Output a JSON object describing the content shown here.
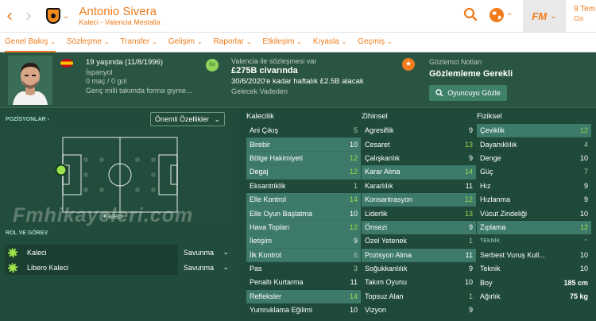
{
  "topbar": {
    "player_name": "Antonio Sivera",
    "player_sub": "Kaleci - Valencia Mestalla",
    "date_main": "9 Tem",
    "date_sub": "Cts"
  },
  "menu": [
    {
      "label": "Genel Bakış",
      "chev": "⌄",
      "active": true
    },
    {
      "label": "Sözleşme",
      "chev": "⌄"
    },
    {
      "label": "Transfer",
      "chev": "⌄"
    },
    {
      "label": "Gelişim",
      "chev": "⌄"
    },
    {
      "label": "Raporlar",
      "chev": "⌄"
    },
    {
      "label": "Etkileşim",
      "chev": "⌄"
    },
    {
      "label": "Kıyasla",
      "chev": "⌄"
    },
    {
      "label": "Geçmiş",
      "chev": "⌄"
    }
  ],
  "header": {
    "age": "19 yaşında (11/8/1996)",
    "nationality": "İspanyol",
    "apps": "0 maç / 0 gol",
    "desc": "Genç milli takımda forma giyme...",
    "contract_icon": "Kir",
    "contract_label": "Valencia ile sözleşmesi var",
    "contract_value": "£275B civarında",
    "contract_until": "30/6/2020'e kadar haftalık £2.5B alacak",
    "contract_future": "Gelecek Vadeden",
    "scout_label": "Gözlemci Notları",
    "scout_value": "Gözlemleme Gerekli",
    "scout_button": "Oyuncuyu Gözle"
  },
  "left": {
    "positions_header": "POZİSYONLAR ›",
    "attr_select": "Önemli Özellikler",
    "position_label": "Kaleci",
    "watermark": "Fmhikayeleri.com",
    "roles_header": "ROL VE GÖREV",
    "roles": [
      {
        "name": "Kaleci",
        "duty": "Savunma"
      },
      {
        "name": "Libero Kaleci",
        "duty": "Savunma"
      }
    ]
  },
  "columns": {
    "kalecilik": {
      "title": "Kalecilik",
      "rows": [
        {
          "name": "Ani Çıkış",
          "value": "5",
          "hl": false,
          "tone": "low"
        },
        {
          "name": "Birebir",
          "value": "10",
          "hl": true,
          "tone": "mid"
        },
        {
          "name": "Bölge Hakimiyeti",
          "value": "12",
          "hl": true,
          "tone": "good"
        },
        {
          "name": "Degaj",
          "value": "12",
          "hl": true,
          "tone": "good"
        },
        {
          "name": "Eksantriklik",
          "value": "1",
          "hl": false,
          "tone": "low"
        },
        {
          "name": "Elle Kontrol",
          "value": "14",
          "hl": true,
          "tone": "good"
        },
        {
          "name": "Elle Oyun Başlatma",
          "value": "10",
          "hl": true,
          "tone": "mid"
        },
        {
          "name": "Hava Topları",
          "value": "12",
          "hl": true,
          "tone": "good"
        },
        {
          "name": "İletişim",
          "value": "9",
          "hl": true,
          "tone": "mid"
        },
        {
          "name": "İlk Kontrol",
          "value": "6",
          "hl": true,
          "tone": "low"
        },
        {
          "name": "Pas",
          "value": "3",
          "hl": false,
          "tone": "low"
        },
        {
          "name": "Penaltı Kurtarma",
          "value": "11",
          "hl": false,
          "tone": "mid"
        },
        {
          "name": "Refleksler",
          "value": "14",
          "hl": true,
          "tone": "good"
        },
        {
          "name": "Yumruklama Eğilimi",
          "value": "10",
          "hl": false,
          "tone": "mid"
        }
      ]
    },
    "zihinsel": {
      "title": "Zihinsel",
      "rows": [
        {
          "name": "Agresiflik",
          "value": "9",
          "hl": false,
          "tone": "mid"
        },
        {
          "name": "Cesaret",
          "value": "13",
          "hl": false,
          "tone": "good"
        },
        {
          "name": "Çalışkanlık",
          "value": "9",
          "hl": false,
          "tone": "mid"
        },
        {
          "name": "Karar Alma",
          "value": "14",
          "hl": true,
          "tone": "good"
        },
        {
          "name": "Kararlılık",
          "value": "11",
          "hl": false,
          "tone": "mid"
        },
        {
          "name": "Konsantrasyon",
          "value": "12",
          "hl": true,
          "tone": "good"
        },
        {
          "name": "Liderlik",
          "value": "13",
          "hl": false,
          "tone": "good"
        },
        {
          "name": "Önsezi",
          "value": "9",
          "hl": true,
          "tone": "mid"
        },
        {
          "name": "Özel Yetenek",
          "value": "1",
          "hl": false,
          "tone": "low"
        },
        {
          "name": "Pozisyon Alma",
          "value": "11",
          "hl": true,
          "tone": "mid"
        },
        {
          "name": "Soğukkanlılık",
          "value": "9",
          "hl": false,
          "tone": "mid"
        },
        {
          "name": "Takım Oyunu",
          "value": "10",
          "hl": false,
          "tone": "mid"
        },
        {
          "name": "Topsuz Alan",
          "value": "1",
          "hl": false,
          "tone": "low"
        },
        {
          "name": "Vizyon",
          "value": "9",
          "hl": false,
          "tone": "mid"
        }
      ]
    },
    "fiziksel": {
      "title": "Fiziksel",
      "rows": [
        {
          "name": "Çeviklik",
          "value": "12",
          "hl": true,
          "tone": "good"
        },
        {
          "name": "Dayanıklılık",
          "value": "4",
          "hl": false,
          "tone": "low"
        },
        {
          "name": "Denge",
          "value": "10",
          "hl": false,
          "tone": "mid"
        },
        {
          "name": "Güç",
          "value": "7",
          "hl": false,
          "tone": "low"
        },
        {
          "name": "Hız",
          "value": "9",
          "hl": false,
          "tone": "mid"
        },
        {
          "name": "Hızlanma",
          "value": "9",
          "hl": false,
          "tone": "mid"
        },
        {
          "name": "Vücut Zindeliği",
          "value": "10",
          "hl": false,
          "tone": "mid"
        },
        {
          "name": "Zıplama",
          "value": "12",
          "hl": true,
          "tone": "good"
        }
      ],
      "technical_header": "TEKNİK",
      "technical_rows": [
        {
          "name": "Serbest Vuruş Kull...",
          "value": "10"
        },
        {
          "name": "Teknik",
          "value": "10"
        }
      ],
      "info_rows": [
        {
          "name": "Boy",
          "value": "185 cm"
        },
        {
          "name": "Ağırlık",
          "value": "75 kg"
        }
      ]
    }
  },
  "colors": {
    "accent": "#f07c1c",
    "panel": "#214b3a",
    "highlight": "#3e7a6a",
    "good_value": "#9ad94c"
  },
  "icons": [
    "back-arrow-icon",
    "forward-arrow-icon",
    "search-icon",
    "globe-icon",
    "star-icon",
    "search-icon"
  ]
}
